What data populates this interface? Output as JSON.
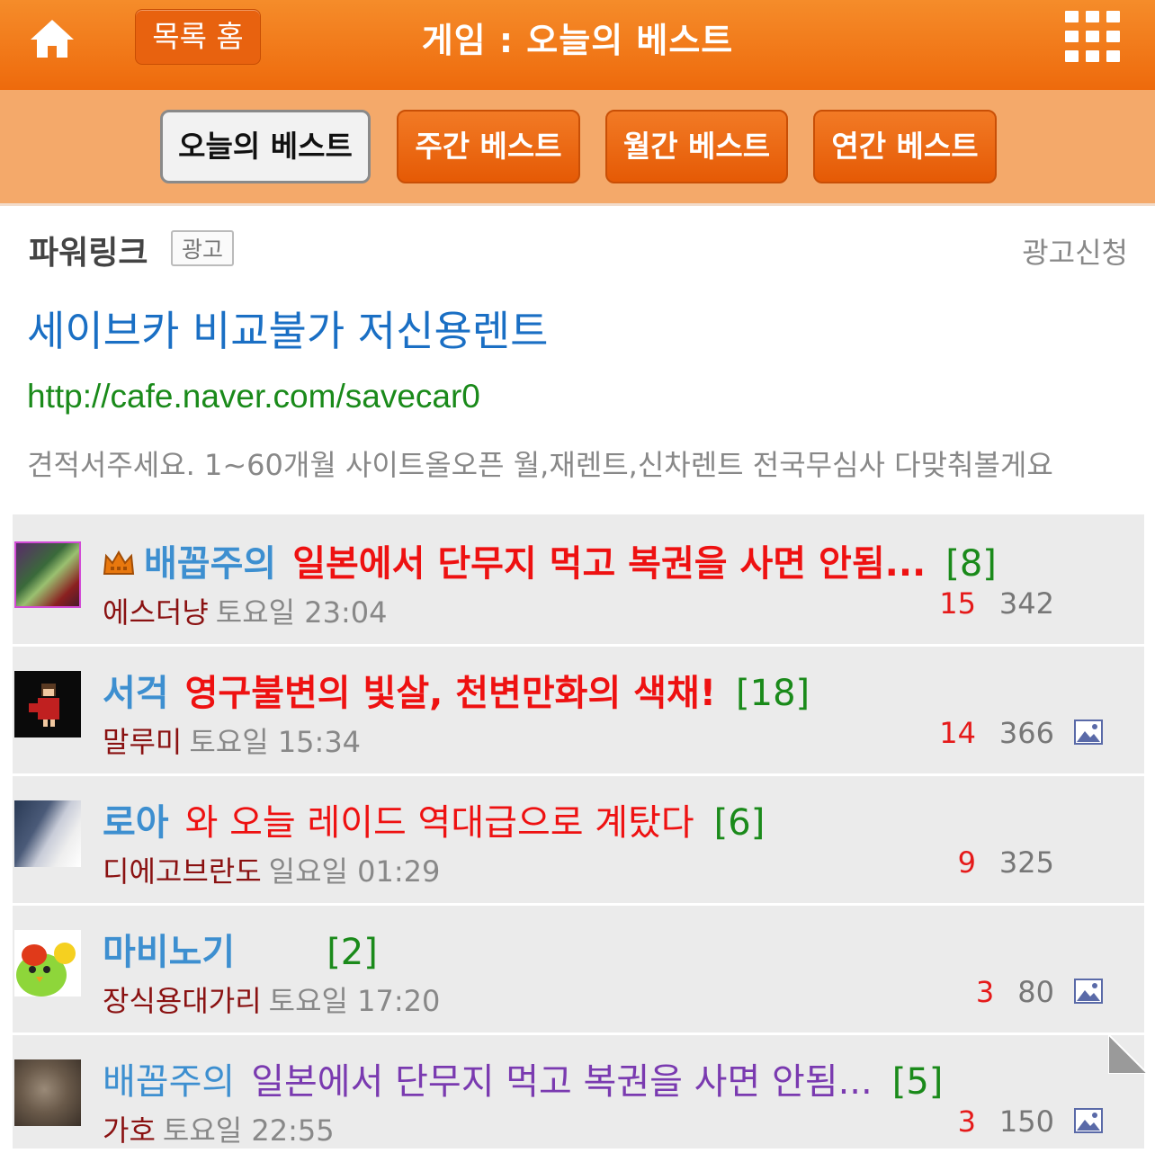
{
  "header": {
    "home_icon": "home-icon",
    "list_home_label": "목록 홈",
    "title": "게임 : 오늘의 베스트",
    "menu_icon": "grid-menu-icon"
  },
  "tabs": [
    {
      "label": "오늘의 베스트",
      "active": true
    },
    {
      "label": "주간 베스트",
      "active": false
    },
    {
      "label": "월간 베스트",
      "active": false
    },
    {
      "label": "연간 베스트",
      "active": false
    }
  ],
  "powerlink": {
    "label": "파워링크",
    "badge": "광고",
    "apply": "광고신청",
    "ad_title": "세이브카 비교불가 저신용렌트",
    "ad_url": "http://cafe.naver.com/savecar0",
    "ad_desc": "견적서주세요. 1~60개월 사이트올오픈 월,재렌트,신차렌트 전국무심사 다맞춰볼게요"
  },
  "posts": [
    {
      "cafe": "배꼽주의",
      "title": "일본에서 단무지 먹고 복권을 사면 안됨...",
      "comments": "[8]",
      "author": "에스더냥",
      "time": "토요일 23:04",
      "likes": "15",
      "views": "342",
      "has_image": false,
      "crown": true
    },
    {
      "cafe": "서걱",
      "title": "영구불변의 빛살, 천변만화의 색채!",
      "comments": "[18]",
      "author": "말루미",
      "time": "토요일 15:34",
      "likes": "14",
      "views": "366",
      "has_image": true,
      "crown": false
    },
    {
      "cafe": "로아",
      "title": "와 오늘 레이드 역대급으로 계탔다",
      "comments": "[6]",
      "author": "디에고브란도",
      "time": "일요일 01:29",
      "likes": "9",
      "views": "325",
      "has_image": false,
      "crown": false
    },
    {
      "cafe": "마비노기",
      "title": "",
      "comments": "[2]",
      "author": "장식용대가리",
      "time": "토요일 17:20",
      "likes": "3",
      "views": "80",
      "has_image": true,
      "crown": false
    },
    {
      "cafe": "배꼽주의",
      "title": "일본에서 단무지 먹고 복권을 사면 안됨...",
      "comments": "[5]",
      "author": "가호",
      "time": "토요일 22:55",
      "likes": "3",
      "views": "150",
      "has_image": true,
      "crown": false
    }
  ],
  "colors": {
    "header_orange": "#ee6a0c",
    "tabbar": "#f4a96a",
    "cafe_blue": "#3d8fd0",
    "title_red": "#ee1111",
    "title_purple": "#7a3ab0",
    "count_green": "#1a8a1a",
    "author_maroon": "#8a1111"
  }
}
